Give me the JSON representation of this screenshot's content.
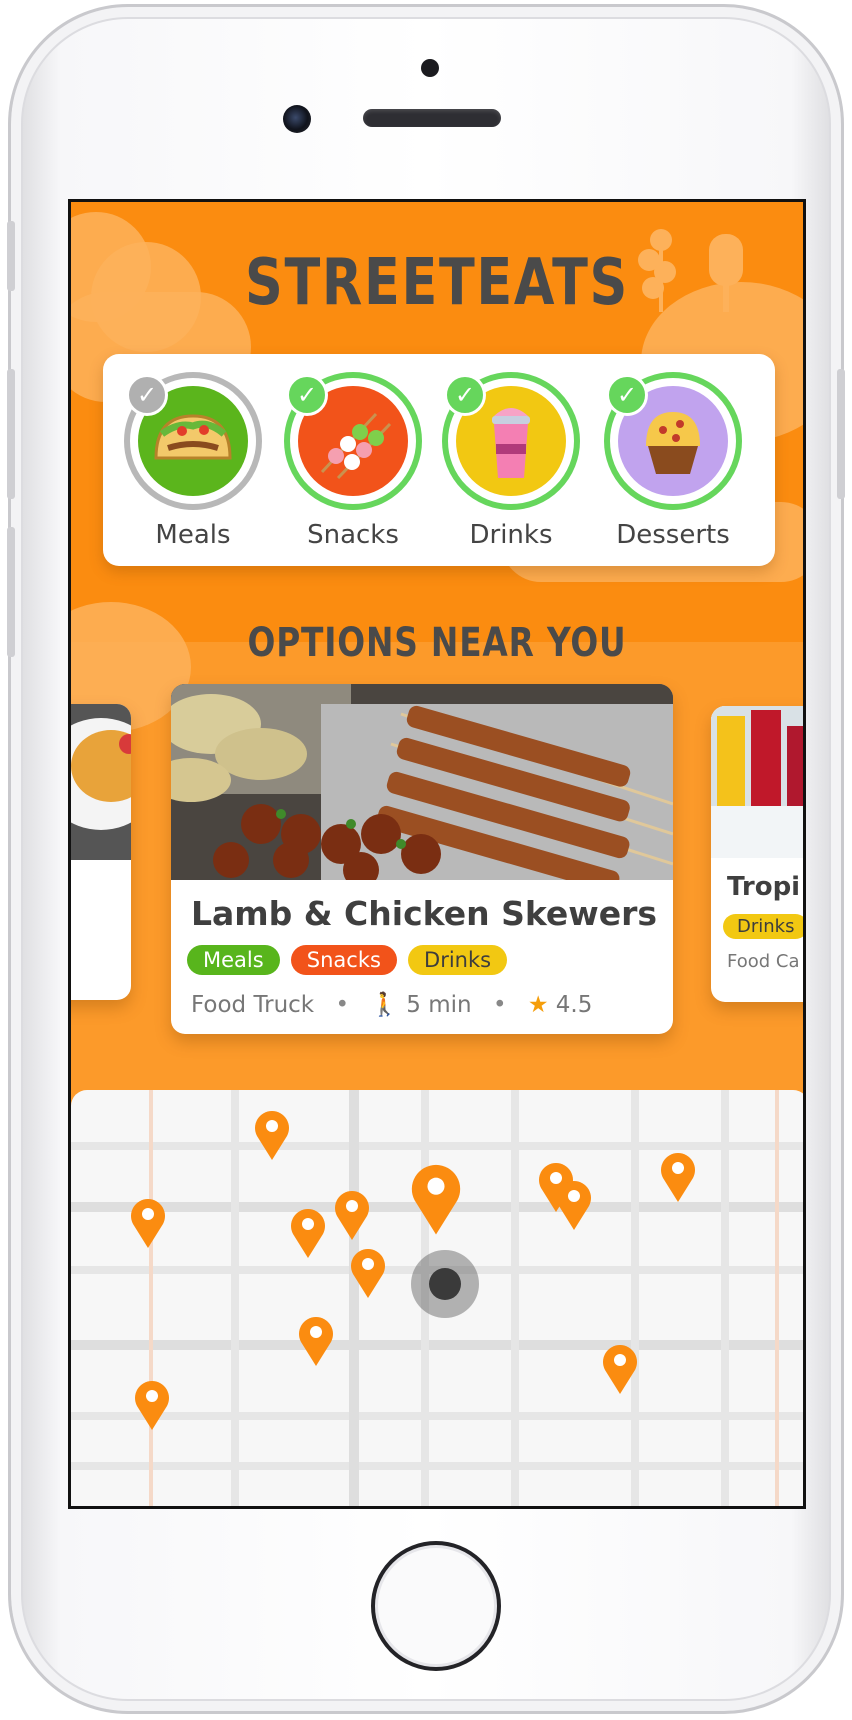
{
  "app": {
    "logo": "STREETEATS",
    "brand_color": "#fb8c10"
  },
  "categories": [
    {
      "label": "Meals",
      "selected": false,
      "icon": "taco-icon",
      "color": "#5bb51c"
    },
    {
      "label": "Snacks",
      "selected": true,
      "icon": "skewers-icon",
      "color": "#f2531a"
    },
    {
      "label": "Drinks",
      "selected": true,
      "icon": "milkshake-icon",
      "color": "#f2c812"
    },
    {
      "label": "Desserts",
      "selected": true,
      "icon": "cupcake-icon",
      "color": "#c1a3ee"
    }
  ],
  "section_title": "OPTIONS NEAR YOU",
  "featured": {
    "title": "Lamb & Chicken Skewers",
    "tags": [
      "Meals",
      "Snacks",
      "Drinks"
    ],
    "vendor_type": "Food Truck",
    "walk_time": "5 min",
    "rating": "4.5"
  },
  "side_card_right": {
    "title": "Tropi",
    "tag": "Drinks",
    "vendor_type": "Food Ca"
  }
}
